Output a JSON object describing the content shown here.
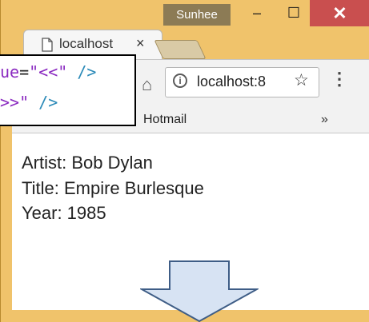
{
  "window": {
    "user_name": "Sunhee",
    "minimize_symbol": "‒",
    "maximize_symbol": "☐",
    "close_symbol": "✕"
  },
  "tab": {
    "title": "localhost",
    "close_symbol": "×",
    "favicon": "page-icon"
  },
  "toolbar": {
    "home_icon": "home-icon",
    "address": "localhost:8",
    "info_symbol": "i",
    "bookmark_symbol": "☆",
    "menu_symbol": "⋮"
  },
  "bookmarks_bar": {
    "items": [
      "Hotmail"
    ],
    "overflow_symbol": "»"
  },
  "page": {
    "artist": "Artist: Bob Dylan",
    "title": "Title: Empire Burlesque",
    "year": "Year: 1985"
  },
  "code_snippet": {
    "line1": {
      "attr": "ue",
      "eq": "=",
      "str": "\"<<\"",
      "tag": " />"
    },
    "line2": {
      "str": ">>\"",
      "tag": " />"
    }
  },
  "colors": {
    "window_frame": "#f0c36b",
    "close_button": "#c94f4f",
    "code_string": "#8a2ac0",
    "code_tag": "#2b8ab8",
    "arrow_fill": "#d7e3f3",
    "arrow_stroke": "#3e5d86"
  },
  "decorations": {
    "arrow": "down-arrow"
  }
}
